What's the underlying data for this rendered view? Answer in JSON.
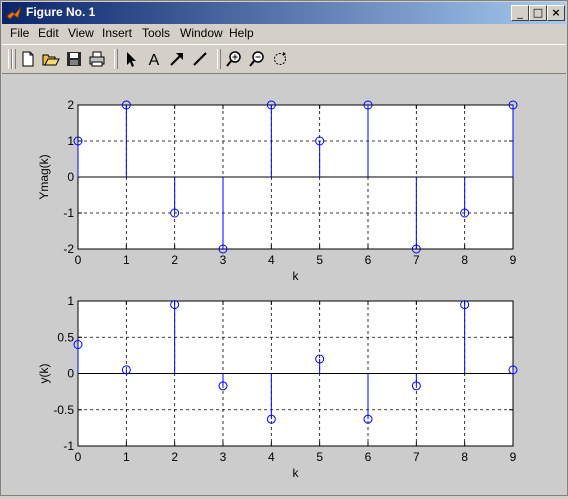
{
  "window": {
    "title": "Figure No. 1"
  },
  "caption_buttons": {
    "minimize": "_",
    "maximize": "□",
    "close": "×"
  },
  "menu": [
    "File",
    "Edit",
    "View",
    "Insert",
    "Tools",
    "Window",
    "Help"
  ],
  "toolbar": {
    "buttons": [
      "new-icon",
      "open-icon",
      "save-icon",
      "print-icon",
      "select-arrow-icon",
      "text-A-icon",
      "arrow-icon",
      "line-icon",
      "zoom-in-icon",
      "zoom-out-icon",
      "rotate-icon"
    ],
    "text_tool_glyph": "A"
  },
  "colors": {
    "stem": "#0000ff",
    "axes_bg": "#ffffff",
    "figure_bg": "#cccccc",
    "title_start": "#0a246a",
    "title_end": "#a6caf0"
  },
  "chart_data": [
    {
      "type": "stem",
      "xlabel": "k",
      "ylabel": "Ymag(k)",
      "x": [
        0,
        1,
        2,
        3,
        4,
        5,
        6,
        7,
        8,
        9
      ],
      "values": [
        1,
        2,
        -1,
        -2,
        2,
        1,
        2,
        -2,
        -1,
        2
      ],
      "xlim": [
        0,
        9
      ],
      "ylim": [
        -2,
        2
      ],
      "xticks": [
        0,
        1,
        2,
        3,
        4,
        5,
        6,
        7,
        8,
        9
      ],
      "yticks": [
        -2,
        -1,
        0,
        1,
        2
      ],
      "ytick_labels": [
        "-2",
        "-1",
        "0",
        "1",
        "2"
      ],
      "grid": true
    },
    {
      "type": "stem",
      "xlabel": "k",
      "ylabel": "y(k)",
      "x": [
        0,
        1,
        2,
        3,
        4,
        5,
        6,
        7,
        8,
        9
      ],
      "values": [
        0.4,
        0.05,
        0.95,
        -0.17,
        -0.63,
        0.2,
        -0.63,
        -0.17,
        0.95,
        0.05
      ],
      "xlim": [
        0,
        9
      ],
      "ylim": [
        -1,
        1
      ],
      "xticks": [
        0,
        1,
        2,
        3,
        4,
        5,
        6,
        7,
        8,
        9
      ],
      "yticks": [
        -1,
        -0.5,
        0,
        0.5,
        1
      ],
      "ytick_labels": [
        "-1",
        "-0.5",
        "0",
        "0.5",
        "1"
      ],
      "grid": true
    }
  ]
}
